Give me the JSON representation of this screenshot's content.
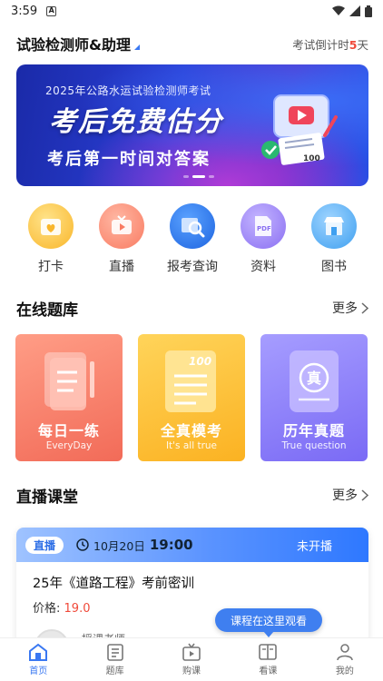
{
  "status_bar": {
    "time": "3:59",
    "notif_badge": "A"
  },
  "header": {
    "title": "试验检测师&助理",
    "countdown_prefix": "考试倒计时",
    "countdown_days": "5",
    "countdown_unit": "天"
  },
  "banner": {
    "subtitle": "2025年公路水运试验检测师考试",
    "headline": "考后免费估分",
    "tagline": "考后第一时间对答案",
    "score_label": "100",
    "active_dot": 1
  },
  "quick_actions": [
    {
      "label": "打卡",
      "icon": "calendar-heart-icon",
      "color": "#f9b62a"
    },
    {
      "label": "直播",
      "icon": "tv-play-icon",
      "color": "#f97b62"
    },
    {
      "label": "报考查询",
      "icon": "search-doc-icon",
      "color": "#2e7cf6"
    },
    {
      "label": "资料",
      "icon": "pdf-icon",
      "color": "#8a6ff2"
    },
    {
      "label": "图书",
      "icon": "store-icon",
      "color": "#3fa0f0"
    }
  ],
  "question_bank": {
    "title": "在线题库",
    "more": "更多",
    "cards": [
      {
        "title": "每日一练",
        "subtitle": "EveryDay",
        "icon": "daily-practice-icon"
      },
      {
        "title": "全真模考",
        "subtitle": "It's all true",
        "icon": "mock-exam-icon",
        "art_text": "100"
      },
      {
        "title": "历年真题",
        "subtitle": "True question",
        "icon": "past-papers-icon",
        "art_text": "真"
      }
    ]
  },
  "live": {
    "title": "直播课堂",
    "more": "更多",
    "card": {
      "badge": "直播",
      "date": "10月20日",
      "time": "19:00",
      "status": "未开播",
      "course_name": "25年《道路工程》考前密训",
      "price_label": "价格:",
      "price": "19.0",
      "teacher": "授课老师"
    }
  },
  "tooltip": "课程在这里观看",
  "tabbar": [
    {
      "label": "首页",
      "icon": "home-icon",
      "active": true
    },
    {
      "label": "题库",
      "icon": "question-bank-icon",
      "active": false
    },
    {
      "label": "购课",
      "icon": "buy-course-icon",
      "active": false
    },
    {
      "label": "看课",
      "icon": "watch-course-icon",
      "active": false
    },
    {
      "label": "我的",
      "icon": "profile-icon",
      "active": false
    }
  ],
  "colors": {
    "accent": "#3a78f2",
    "danger": "#f04a3a"
  }
}
